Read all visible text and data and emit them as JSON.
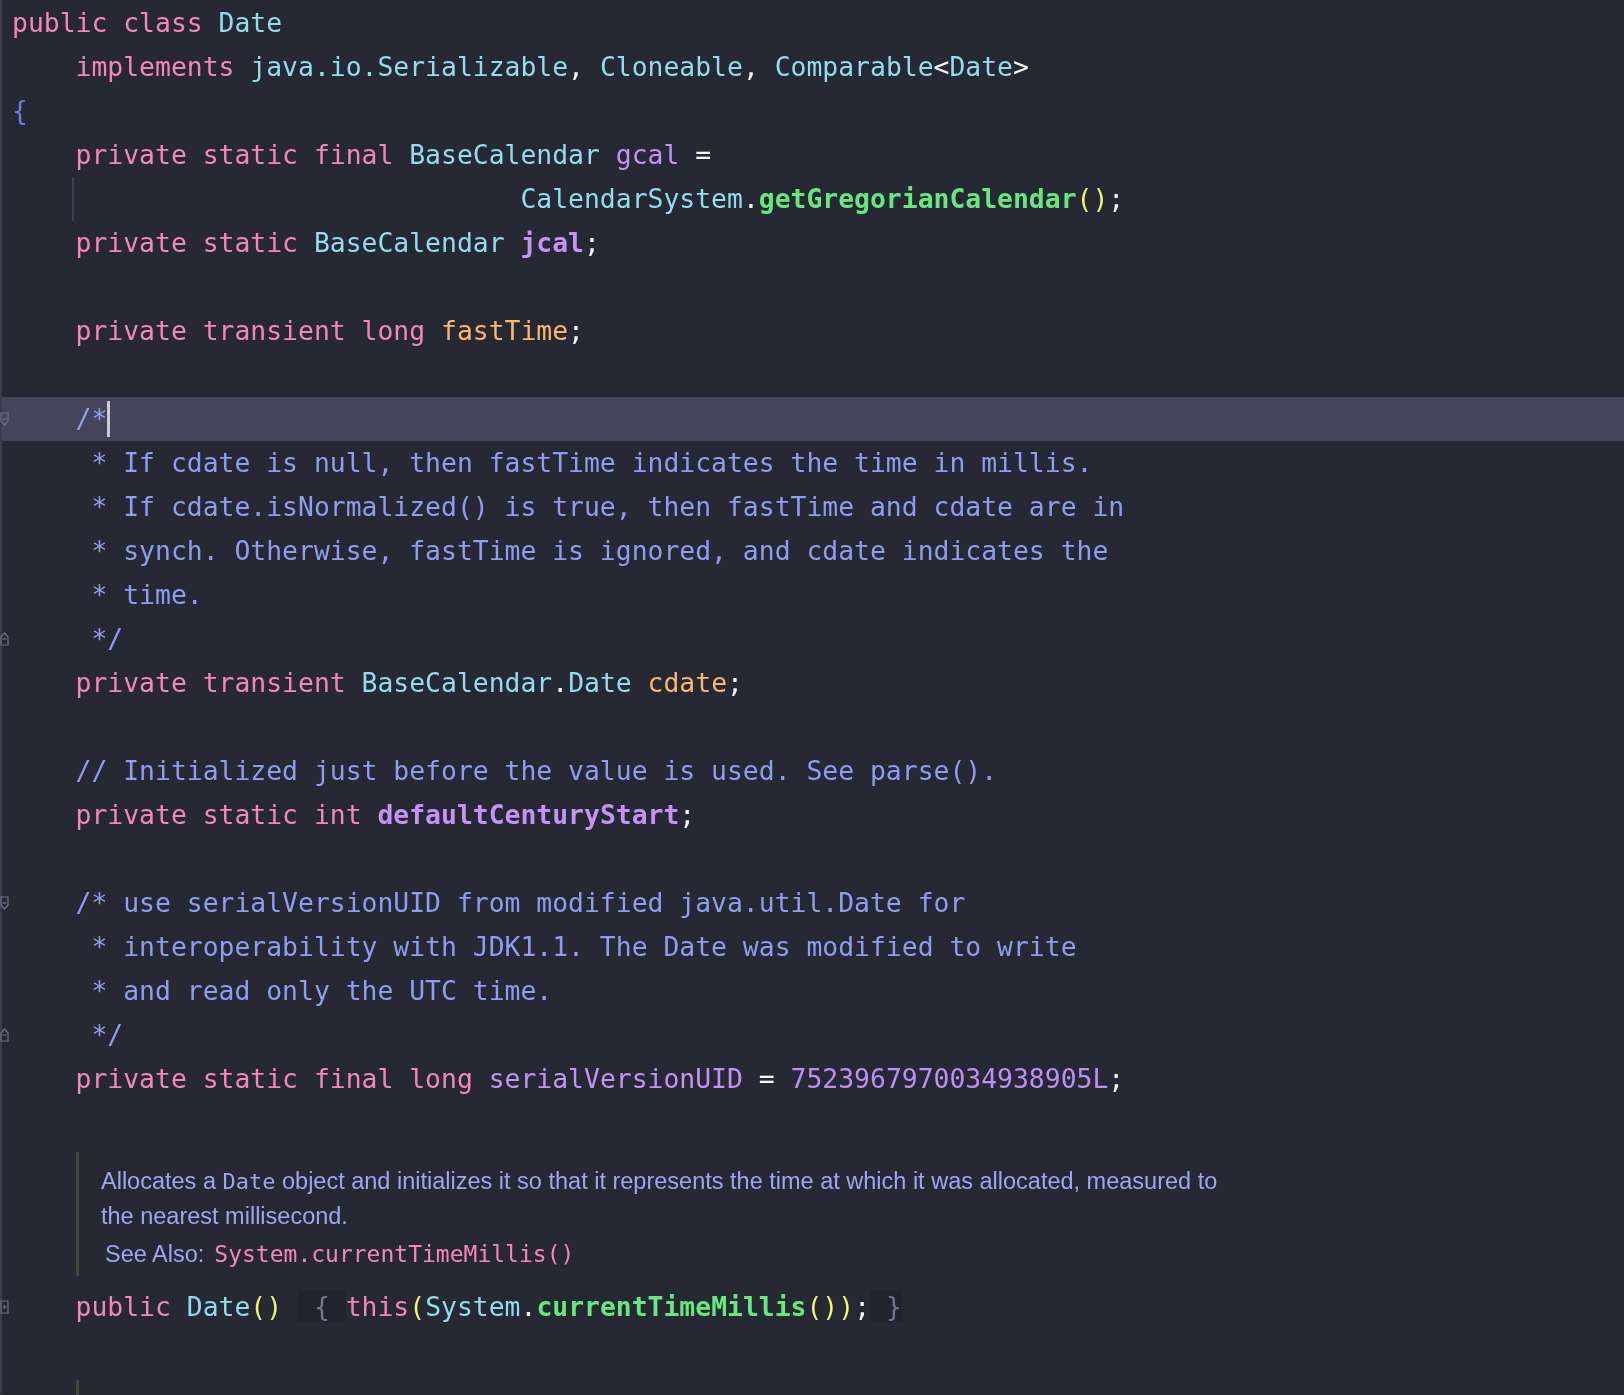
{
  "editor": {
    "blocks": [
      {
        "kind": "code",
        "lines": [
          {
            "kind": "code",
            "tokens": [
              {
                "kind": "keyword",
                "text": "public class "
              },
              {
                "kind": "type",
                "text": "Date"
              }
            ]
          },
          {
            "kind": "code",
            "tokens": [
              {
                "kind": "keyword",
                "text": "    implements "
              },
              {
                "kind": "type",
                "text": "java.io.Serializable"
              },
              {
                "kind": "plain",
                "text": ", "
              },
              {
                "kind": "type",
                "text": "Cloneable"
              },
              {
                "kind": "plain",
                "text": ", "
              },
              {
                "kind": "type",
                "text": "Comparable"
              },
              {
                "kind": "plain",
                "text": "<"
              },
              {
                "kind": "type",
                "text": "Date"
              },
              {
                "kind": "plain",
                "text": ">"
              }
            ]
          },
          {
            "kind": "code",
            "tokens": [
              {
                "kind": "brace",
                "text": "{"
              }
            ]
          },
          {
            "kind": "code",
            "tokens": [
              {
                "kind": "keyword",
                "text": "    private static final "
              },
              {
                "kind": "type",
                "text": "BaseCalendar "
              },
              {
                "kind": "field",
                "text": "gcal"
              },
              {
                "kind": "plain",
                "text": " ="
              }
            ]
          },
          {
            "kind": "code",
            "guide": true,
            "tokens": [
              {
                "kind": "type",
                "text": "                                CalendarSystem"
              },
              {
                "kind": "plain",
                "text": "."
              },
              {
                "kind": "method",
                "text": "getGregorianCalendar"
              },
              {
                "kind": "paren",
                "text": "()"
              },
              {
                "kind": "plain",
                "text": ";"
              }
            ]
          },
          {
            "kind": "code",
            "tokens": [
              {
                "kind": "keyword",
                "text": "    private static "
              },
              {
                "kind": "type",
                "text": "BaseCalendar "
              },
              {
                "kind": "static_field",
                "text": "jcal"
              },
              {
                "kind": "plain",
                "text": ";"
              }
            ]
          },
          {
            "kind": "blank"
          },
          {
            "kind": "code",
            "tokens": [
              {
                "kind": "keyword",
                "text": "    private transient long "
              },
              {
                "kind": "transient_field",
                "text": "fastTime"
              },
              {
                "kind": "plain",
                "text": ";"
              }
            ]
          },
          {
            "kind": "blank"
          },
          {
            "kind": "code",
            "current": true,
            "caret": true,
            "fold_start": true,
            "tokens": [
              {
                "kind": "comment",
                "text": "    /*"
              }
            ]
          },
          {
            "kind": "code",
            "tokens": [
              {
                "kind": "comment",
                "text": "     * If cdate is null, then fastTime indicates the time in millis."
              }
            ]
          },
          {
            "kind": "code",
            "tokens": [
              {
                "kind": "comment",
                "text": "     * If cdate.isNormalized() is true, then fastTime and cdate are in"
              }
            ]
          },
          {
            "kind": "code",
            "tokens": [
              {
                "kind": "comment",
                "text": "     * synch. Otherwise, fastTime is ignored, and cdate indicates the"
              }
            ]
          },
          {
            "kind": "code",
            "tokens": [
              {
                "kind": "comment",
                "text": "     * time."
              }
            ]
          },
          {
            "kind": "code",
            "fold_end": true,
            "tokens": [
              {
                "kind": "comment",
                "text": "     */"
              }
            ]
          },
          {
            "kind": "code",
            "tokens": [
              {
                "kind": "keyword",
                "text": "    private transient "
              },
              {
                "kind": "type",
                "text": "BaseCalendar"
              },
              {
                "kind": "plain",
                "text": "."
              },
              {
                "kind": "type",
                "text": "Date "
              },
              {
                "kind": "transient_field",
                "text": "cdate"
              },
              {
                "kind": "plain",
                "text": ";"
              }
            ]
          },
          {
            "kind": "blank"
          },
          {
            "kind": "code",
            "tokens": [
              {
                "kind": "comment",
                "text": "    // Initialized just before the value is used. See parse()."
              }
            ]
          },
          {
            "kind": "code",
            "tokens": [
              {
                "kind": "keyword",
                "text": "    private static int "
              },
              {
                "kind": "static_field",
                "text": "defaultCenturyStart"
              },
              {
                "kind": "plain",
                "text": ";"
              }
            ]
          },
          {
            "kind": "blank"
          },
          {
            "kind": "code",
            "fold_start": true,
            "tokens": [
              {
                "kind": "comment",
                "text": "    /* use serialVersionUID from modified java.util.Date for"
              }
            ]
          },
          {
            "kind": "code",
            "tokens": [
              {
                "kind": "comment",
                "text": "     * interoperability with JDK1.1. The Date was modified to write"
              }
            ]
          },
          {
            "kind": "code",
            "tokens": [
              {
                "kind": "comment",
                "text": "     * and read only the UTC time."
              }
            ]
          },
          {
            "kind": "code",
            "fold_end": true,
            "tokens": [
              {
                "kind": "comment",
                "text": "     */"
              }
            ]
          },
          {
            "kind": "code",
            "tokens": [
              {
                "kind": "keyword",
                "text": "    private static final long "
              },
              {
                "kind": "field",
                "text": "serialVersionUID"
              },
              {
                "kind": "plain",
                "text": " = "
              },
              {
                "kind": "number",
                "text": "7523967970034938905L"
              },
              {
                "kind": "plain",
                "text": ";"
              }
            ]
          },
          {
            "kind": "blank"
          }
        ]
      },
      {
        "kind": "doc",
        "paragraph": [
          {
            "kind": "text",
            "text": "Allocates a "
          },
          {
            "kind": "code",
            "text": "Date"
          },
          {
            "kind": "text",
            "text": " object and initializes it so that it represents the time at which it was allocated, measured to the nearest millisecond."
          }
        ],
        "see_also": {
          "label": "See Also:",
          "link": "System.currentTimeMillis()"
        }
      },
      {
        "kind": "code",
        "lines": [
          {
            "kind": "code",
            "folded": true,
            "tokens": [
              {
                "kind": "keyword",
                "text": "    public "
              },
              {
                "kind": "type",
                "text": "Date"
              },
              {
                "kind": "paren",
                "text": "() "
              },
              {
                "kind": "folded",
                "text": " { "
              },
              {
                "kind": "keyword",
                "text": "this"
              },
              {
                "kind": "paren",
                "text": "("
              },
              {
                "kind": "type",
                "text": "System"
              },
              {
                "kind": "plain",
                "text": "."
              },
              {
                "kind": "method",
                "text": "currentTimeMillis"
              },
              {
                "kind": "paren",
                "text": "())"
              },
              {
                "kind": "plain",
                "text": ";"
              },
              {
                "kind": "folded",
                "text": " }"
              }
            ]
          },
          {
            "kind": "blank"
          }
        ]
      },
      {
        "kind": "doc_stub"
      }
    ]
  }
}
